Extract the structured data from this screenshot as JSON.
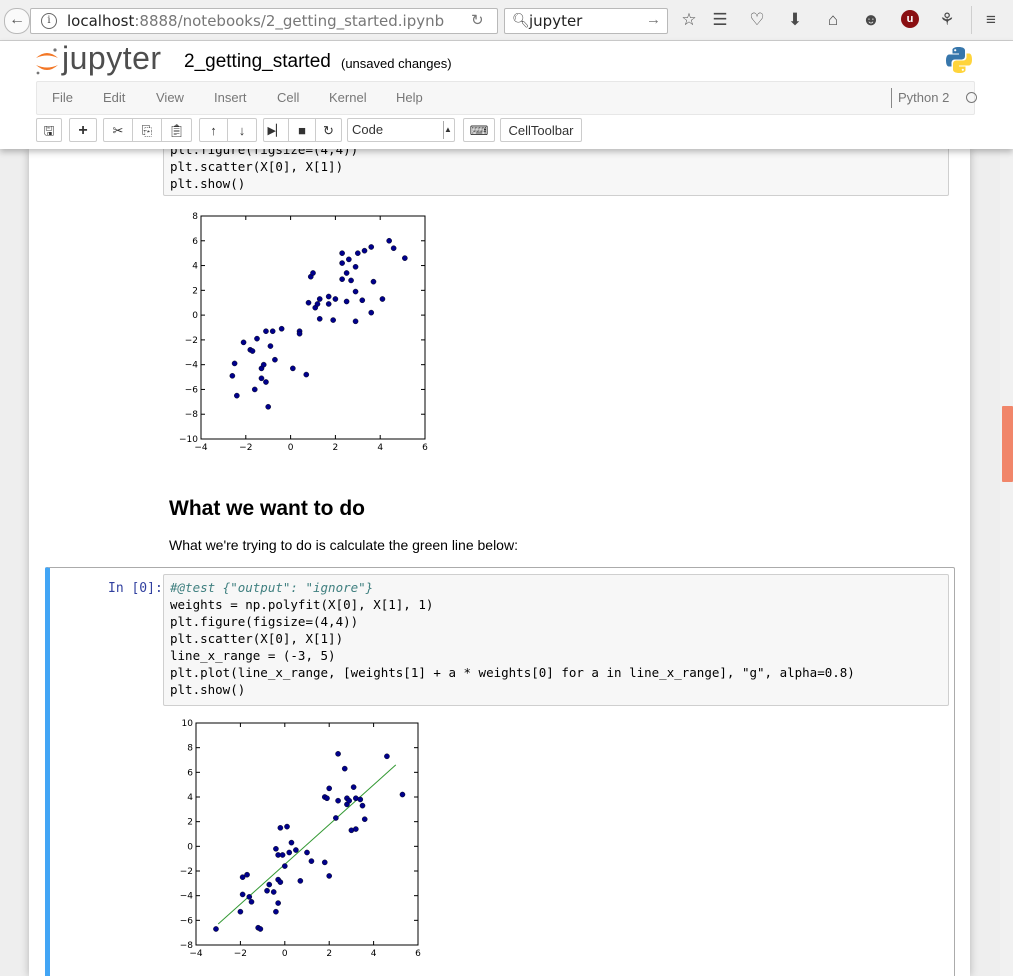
{
  "browser": {
    "url_host": "localhost",
    "url_rest": ":8888/notebooks/2_getting_started.ipynb",
    "search_text": "jupyter"
  },
  "jupyter": {
    "logo_text": "jupyter",
    "notebook_name": "2_getting_started",
    "save_status": "(unsaved changes)",
    "menu": [
      "File",
      "Edit",
      "View",
      "Insert",
      "Cell",
      "Kernel",
      "Help"
    ],
    "kernel_name": "Python 2",
    "cell_type": "Code",
    "celltoolbar_label": "CellToolbar"
  },
  "cells": {
    "partial_code_lines": [
      "plt.figure(figsize=(4,4))",
      "plt.scatter(X[0], X[1])",
      "plt.show()"
    ],
    "markdown_heading": "What we want to do",
    "markdown_text": "What we're trying to do is calculate the green line below:",
    "code_prompt": "In [0]:",
    "code_lines": [
      "#@test {\"output\": \"ignore\"}",
      "weights = np.polyfit(X[0], X[1], 1)",
      "plt.figure(figsize=(4,4))",
      "plt.scatter(X[0], X[1])",
      "line_x_range = (-3, 5)",
      "plt.plot(line_x_range, [weights[1] + a * weights[0] for a in line_x_range], \"g\", alpha=0.8)",
      "plt.show()"
    ]
  },
  "chart_data": [
    {
      "type": "scatter",
      "xlim": [
        -4,
        6
      ],
      "ylim": [
        -10,
        8
      ],
      "xticks": [
        "−4",
        "−2",
        "0",
        "2",
        "4",
        "6"
      ],
      "yticks": [
        "−10",
        "−8",
        "−6",
        "−4",
        "−2",
        "0",
        "2",
        "4",
        "6",
        "8"
      ],
      "marker_color": "#00008b",
      "points": [
        [
          -2.6,
          -4.9
        ],
        [
          -2.5,
          -3.9
        ],
        [
          -2.4,
          -6.5
        ],
        [
          -2.1,
          -2.2
        ],
        [
          -1.8,
          -2.8
        ],
        [
          -1.7,
          -2.9
        ],
        [
          -1.6,
          -6.0
        ],
        [
          -1.5,
          -1.9
        ],
        [
          -1.3,
          -4.3
        ],
        [
          -1.3,
          -5.1
        ],
        [
          -1.2,
          -4.0
        ],
        [
          -1.1,
          -1.3
        ],
        [
          -1.1,
          -5.4
        ],
        [
          -1.0,
          -7.4
        ],
        [
          -0.9,
          -2.5
        ],
        [
          -0.8,
          -1.3
        ],
        [
          -0.7,
          -3.6
        ],
        [
          -0.4,
          -1.1
        ],
        [
          0.1,
          -4.3
        ],
        [
          0.4,
          -1.3
        ],
        [
          0.4,
          -1.5
        ],
        [
          0.7,
          -4.8
        ],
        [
          0.8,
          1.0
        ],
        [
          0.9,
          3.1
        ],
        [
          1.0,
          3.4
        ],
        [
          1.1,
          0.6
        ],
        [
          1.2,
          0.9
        ],
        [
          1.3,
          1.3
        ],
        [
          1.3,
          -0.3
        ],
        [
          1.7,
          0.9
        ],
        [
          1.7,
          1.5
        ],
        [
          1.9,
          -0.4
        ],
        [
          2.0,
          1.3
        ],
        [
          2.3,
          5.0
        ],
        [
          2.3,
          4.2
        ],
        [
          2.3,
          2.9
        ],
        [
          2.5,
          1.1
        ],
        [
          2.5,
          3.4
        ],
        [
          2.6,
          4.5
        ],
        [
          2.7,
          2.8
        ],
        [
          2.9,
          3.9
        ],
        [
          2.9,
          1.9
        ],
        [
          2.9,
          -0.5
        ],
        [
          3.0,
          5.0
        ],
        [
          3.2,
          1.2
        ],
        [
          3.3,
          5.2
        ],
        [
          3.6,
          0.2
        ],
        [
          3.6,
          5.5
        ],
        [
          3.7,
          2.7
        ],
        [
          4.1,
          1.3
        ],
        [
          4.4,
          6.0
        ],
        [
          4.6,
          5.4
        ],
        [
          5.1,
          4.6
        ]
      ]
    },
    {
      "type": "scatter",
      "xlim": [
        -4,
        6
      ],
      "ylim": [
        -8,
        10
      ],
      "xticks": [
        "−4",
        "−2",
        "0",
        "2",
        "4",
        "6"
      ],
      "yticks": [
        "−8",
        "−6",
        "−4",
        "−2",
        "0",
        "2",
        "4",
        "6",
        "8",
        "10"
      ],
      "marker_color": "#00008b",
      "line_color": "#008000",
      "line": [
        [
          -3,
          -6.3
        ],
        [
          5,
          6.6
        ]
      ],
      "points": [
        [
          -3.1,
          -6.7
        ],
        [
          -2.0,
          -5.3
        ],
        [
          -1.9,
          -3.9
        ],
        [
          -1.9,
          -2.5
        ],
        [
          -1.7,
          -2.3
        ],
        [
          -1.6,
          -4.1
        ],
        [
          -1.5,
          -4.5
        ],
        [
          -1.2,
          -6.6
        ],
        [
          -1.1,
          -6.7
        ],
        [
          -0.8,
          -3.6
        ],
        [
          -0.7,
          -3.1
        ],
        [
          -0.5,
          -3.7
        ],
        [
          -0.4,
          -5.3
        ],
        [
          -0.3,
          -4.6
        ],
        [
          -0.3,
          -2.7
        ],
        [
          -0.2,
          -2.9
        ],
        [
          -0.4,
          -0.2
        ],
        [
          -0.3,
          -0.7
        ],
        [
          -0.2,
          1.5
        ],
        [
          -0.1,
          -0.7
        ],
        [
          0.0,
          -1.6
        ],
        [
          0.1,
          1.6
        ],
        [
          0.2,
          -0.5
        ],
        [
          0.3,
          0.3
        ],
        [
          0.5,
          -0.3
        ],
        [
          0.7,
          -2.8
        ],
        [
          1.0,
          -0.5
        ],
        [
          1.2,
          -1.2
        ],
        [
          1.8,
          -1.3
        ],
        [
          1.8,
          4.0
        ],
        [
          1.9,
          3.9
        ],
        [
          2.0,
          -2.4
        ],
        [
          2.0,
          4.7
        ],
        [
          2.3,
          2.3
        ],
        [
          2.4,
          7.5
        ],
        [
          2.4,
          3.7
        ],
        [
          2.7,
          6.3
        ],
        [
          2.8,
          3.9
        ],
        [
          2.8,
          3.4
        ],
        [
          2.9,
          3.7
        ],
        [
          3.0,
          1.3
        ],
        [
          3.1,
          4.8
        ],
        [
          3.2,
          1.4
        ],
        [
          3.2,
          3.9
        ],
        [
          3.4,
          3.8
        ],
        [
          3.5,
          3.3
        ],
        [
          3.6,
          2.2
        ],
        [
          4.6,
          7.3
        ],
        [
          5.3,
          4.2
        ]
      ]
    }
  ]
}
